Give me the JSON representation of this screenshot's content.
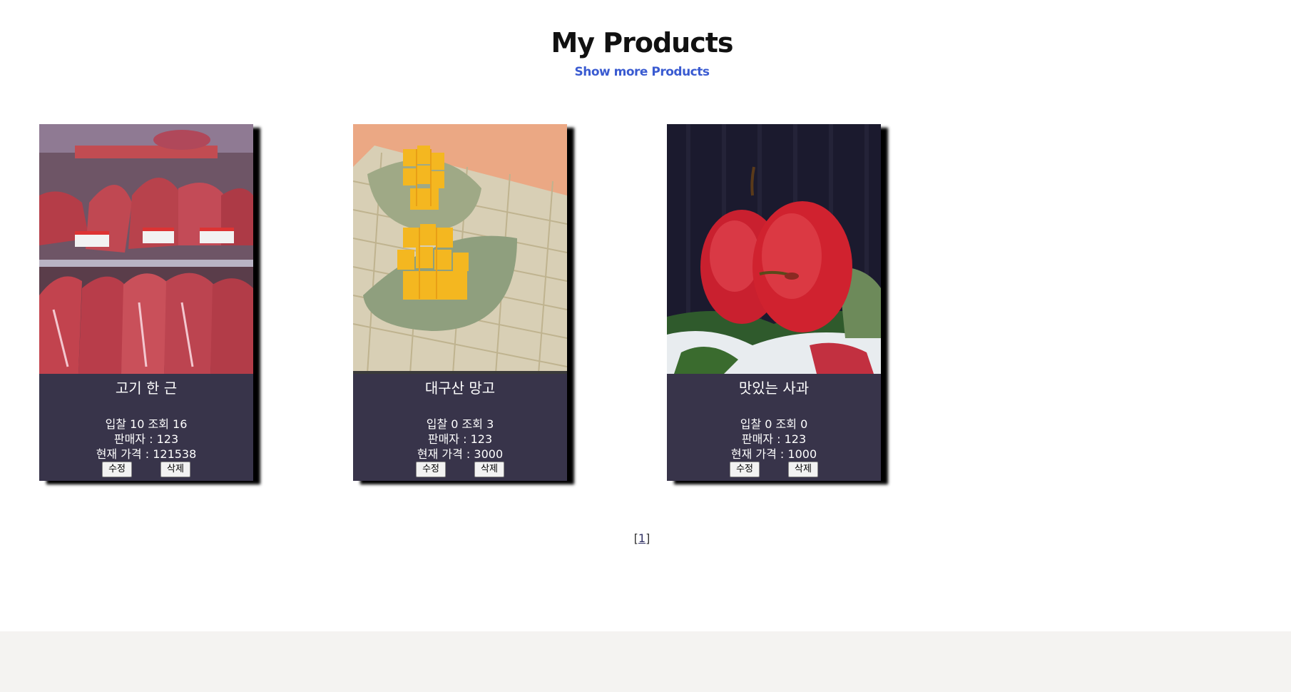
{
  "header": {
    "title": "My Products",
    "show_more_link": "Show more Products"
  },
  "products": [
    {
      "name": "고기 한 근",
      "bids_views": "입찰 10 조회 16",
      "seller": "판매자 : 123",
      "price": "현재 가격 : 121538",
      "image_icon": "meat-photo"
    },
    {
      "name": "대구산 망고",
      "bids_views": "입찰 0 조회 3",
      "seller": "판매자 : 123",
      "price": "현재 가격 : 3000",
      "image_icon": "mango-photo"
    },
    {
      "name": "맛있는 사과",
      "bids_views": "입찰 0 조회 0",
      "seller": "판매자 : 123",
      "price": "현재 가격 : 1000",
      "image_icon": "apple-photo"
    }
  ],
  "buttons": {
    "edit": "수정",
    "delete": "삭제"
  },
  "pagination": {
    "page_1": "1"
  },
  "colors": {
    "card_bg": "#38344a",
    "link": "#3a5bd1",
    "footer_bg": "#f4f3f1"
  }
}
